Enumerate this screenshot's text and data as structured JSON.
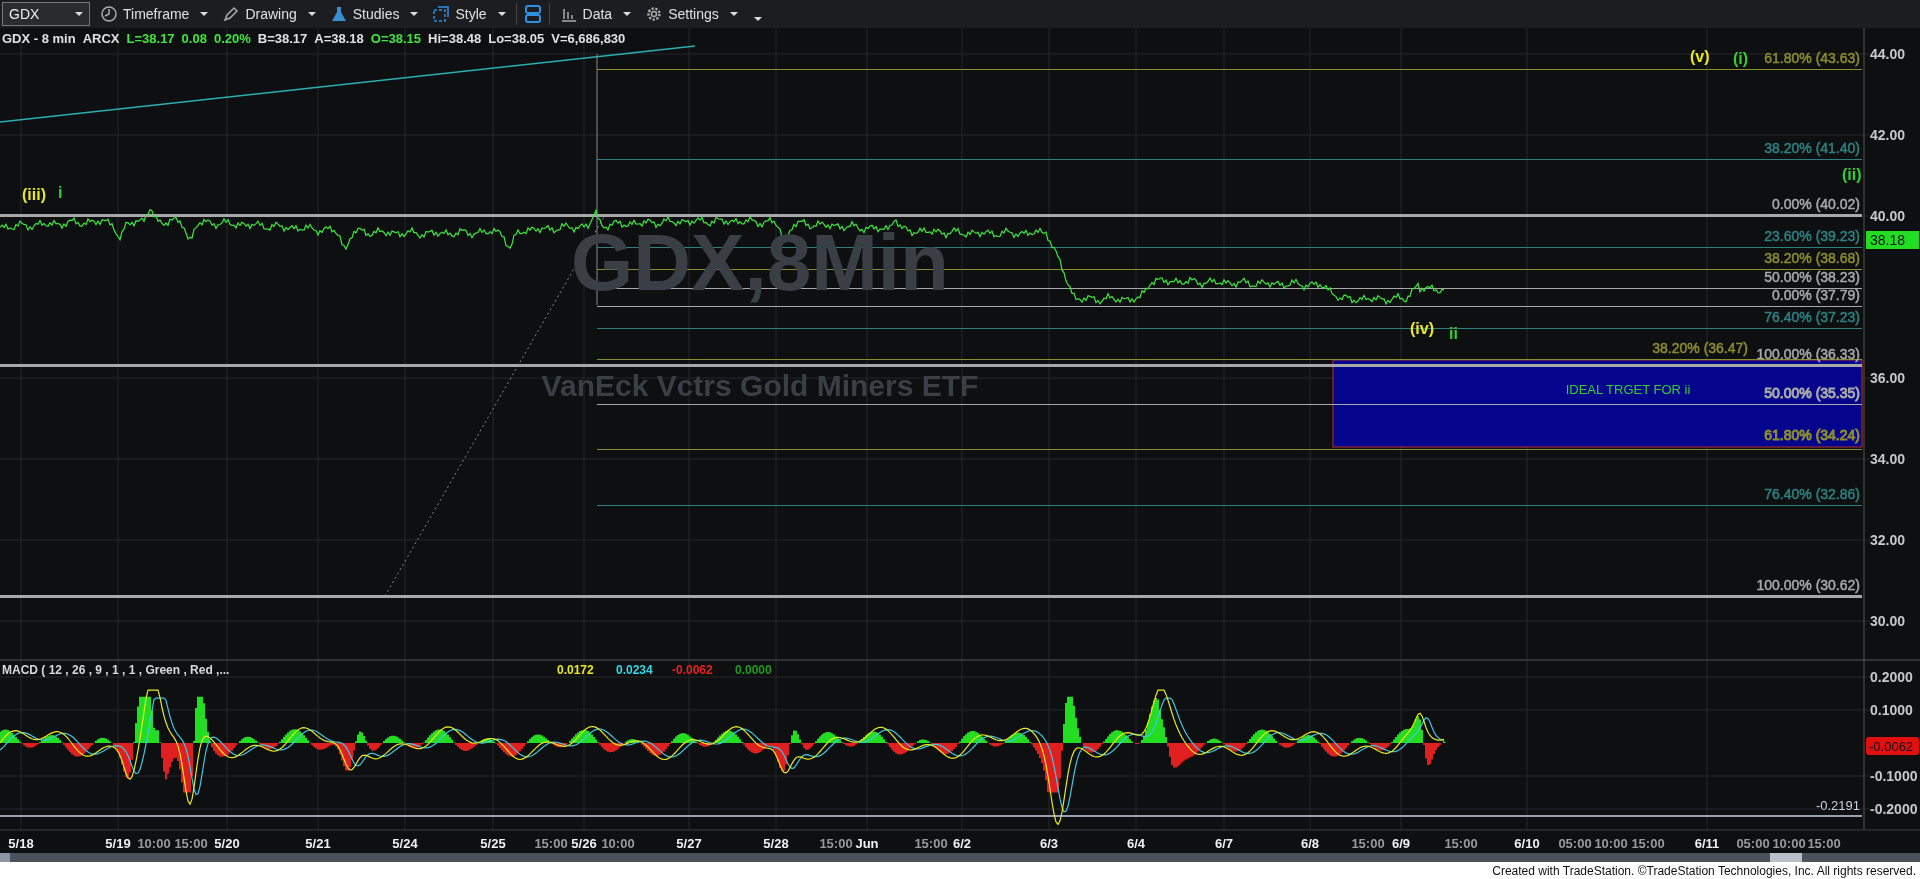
{
  "toolbar": {
    "symbol": "GDX",
    "menus": [
      {
        "label": "Timeframe"
      },
      {
        "label": "Drawing"
      },
      {
        "label": "Studies"
      },
      {
        "label": "Style"
      },
      {
        "label": "Data"
      },
      {
        "label": "Settings"
      }
    ]
  },
  "quote_line": [
    {
      "text": "GDX - 8 min",
      "color": "#e0e0e0"
    },
    {
      "text": "ARCX",
      "color": "#e0e0e0"
    },
    {
      "text": "L=38.17",
      "color": "#3ee63e"
    },
    {
      "text": "0.08",
      "color": "#3ee63e"
    },
    {
      "text": "0.20%",
      "color": "#3ee63e"
    },
    {
      "text": "B=38.17",
      "color": "#e0e0e0"
    },
    {
      "text": "A=38.18",
      "color": "#e0e0e0"
    },
    {
      "text": "O=38.15",
      "color": "#3ee63e"
    },
    {
      "text": "Hi=38.48",
      "color": "#e0e0e0"
    },
    {
      "text": "Lo=38.05",
      "color": "#e0e0e0"
    },
    {
      "text": "V=6,686,830",
      "color": "#e0e0e0"
    }
  ],
  "chart": {
    "watermark_symbol": "GDX,8Min",
    "watermark_name": "VanEck Vctrs Gold Miners ETF",
    "price_axis": [
      "44.00",
      "42.00",
      "40.00",
      "36.00",
      "34.00",
      "32.00",
      "30.00"
    ],
    "last_price": "38.18",
    "wave_labels": [
      {
        "text": "(iii)",
        "color": "#e8e820"
      },
      {
        "text": "i",
        "color": "#30d030"
      },
      {
        "text": "(v)",
        "color": "#e8e820"
      },
      {
        "text": "(i)",
        "color": "#30d030"
      },
      {
        "text": "(ii)",
        "color": "#30d030"
      },
      {
        "text": "(iv)",
        "color": "#e8e820"
      },
      {
        "text": "ii",
        "color": "#30d030"
      }
    ],
    "fib_levels": [
      {
        "label": "61.80% (43.63)",
        "color": "#8c8c30"
      },
      {
        "label": "38.20% (41.40)",
        "color": "#2e8080"
      },
      {
        "label": "0.00% (40.02)",
        "color": "#a8a8a8"
      },
      {
        "label": "23.60% (39.23)",
        "color": "#2e8080"
      },
      {
        "label": "38.20% (38.68)",
        "color": "#8c8c30"
      },
      {
        "label": "50.00% (38.23)",
        "color": "#a8a8a8"
      },
      {
        "label": "0.00% (37.79)",
        "color": "#a8a8a8"
      },
      {
        "label": "76.40% (37.23)",
        "color": "#2e8080"
      },
      {
        "label": "38.20% (36.47)",
        "color": "#8c8c30"
      },
      {
        "label": "100.00% (36.33)",
        "color": "#a8a8a8"
      },
      {
        "label": "50.00% (35.35)",
        "color": "#a8a8a8"
      },
      {
        "label": "61.80% (34.24)",
        "color": "#8c8c30"
      },
      {
        "label": "76.40% (32.86)",
        "color": "#2e8080"
      },
      {
        "label": "100.00% (30.62)",
        "color": "#a8a8a8"
      }
    ],
    "target_zone": {
      "label": "IDEAL TRGET FOR ii"
    }
  },
  "macd": {
    "legend": [
      {
        "text": "MACD ( 12 , 26 , 9 , 1 , 1 , Green , Red ,...",
        "color": "#d8d8d8"
      },
      {
        "text": "0.0172",
        "color": "#e8e820"
      },
      {
        "text": "0.0234",
        "color": "#30d8e8"
      },
      {
        "text": "-0.0062",
        "color": "#e82020"
      },
      {
        "text": "0.0000",
        "color": "#1e9a1e"
      }
    ],
    "axis": [
      "0.2000",
      "0.1000",
      "-0.1000",
      "-0.2000"
    ],
    "last_value": "-0.0062",
    "low_label": "-0.2191"
  },
  "time_axis": [
    {
      "text": "5/18",
      "kind": "date"
    },
    {
      "text": "5/19",
      "kind": "date"
    },
    {
      "text": "10:00",
      "kind": "time"
    },
    {
      "text": "15:00",
      "kind": "time"
    },
    {
      "text": "5/20",
      "kind": "date"
    },
    {
      "text": "5/21",
      "kind": "date"
    },
    {
      "text": "5/24",
      "kind": "date"
    },
    {
      "text": "5/25",
      "kind": "date"
    },
    {
      "text": "15:00",
      "kind": "time"
    },
    {
      "text": "5/26",
      "kind": "date"
    },
    {
      "text": "10:00",
      "kind": "time"
    },
    {
      "text": "5/27",
      "kind": "date"
    },
    {
      "text": "5/28",
      "kind": "date"
    },
    {
      "text": "15:00",
      "kind": "time"
    },
    {
      "text": "Jun",
      "kind": "date"
    },
    {
      "text": "15:00",
      "kind": "time"
    },
    {
      "text": "6/2",
      "kind": "date"
    },
    {
      "text": "6/3",
      "kind": "date"
    },
    {
      "text": "6/4",
      "kind": "date"
    },
    {
      "text": "6/7",
      "kind": "date"
    },
    {
      "text": "6/8",
      "kind": "date"
    },
    {
      "text": "15:00",
      "kind": "time"
    },
    {
      "text": "6/9",
      "kind": "date"
    },
    {
      "text": "15:00",
      "kind": "time"
    },
    {
      "text": "6/10",
      "kind": "date"
    },
    {
      "text": "05:00",
      "kind": "time"
    },
    {
      "text": "10:00",
      "kind": "time"
    },
    {
      "text": "15:00",
      "kind": "time"
    },
    {
      "text": "6/11",
      "kind": "date"
    },
    {
      "text": "05:00",
      "kind": "time"
    },
    {
      "text": "10:00",
      "kind": "time"
    },
    {
      "text": "15:00",
      "kind": "time"
    }
  ],
  "footer": "Created with TradeStation. ©TradeStation Technologies, Inc. All rights reserved."
}
